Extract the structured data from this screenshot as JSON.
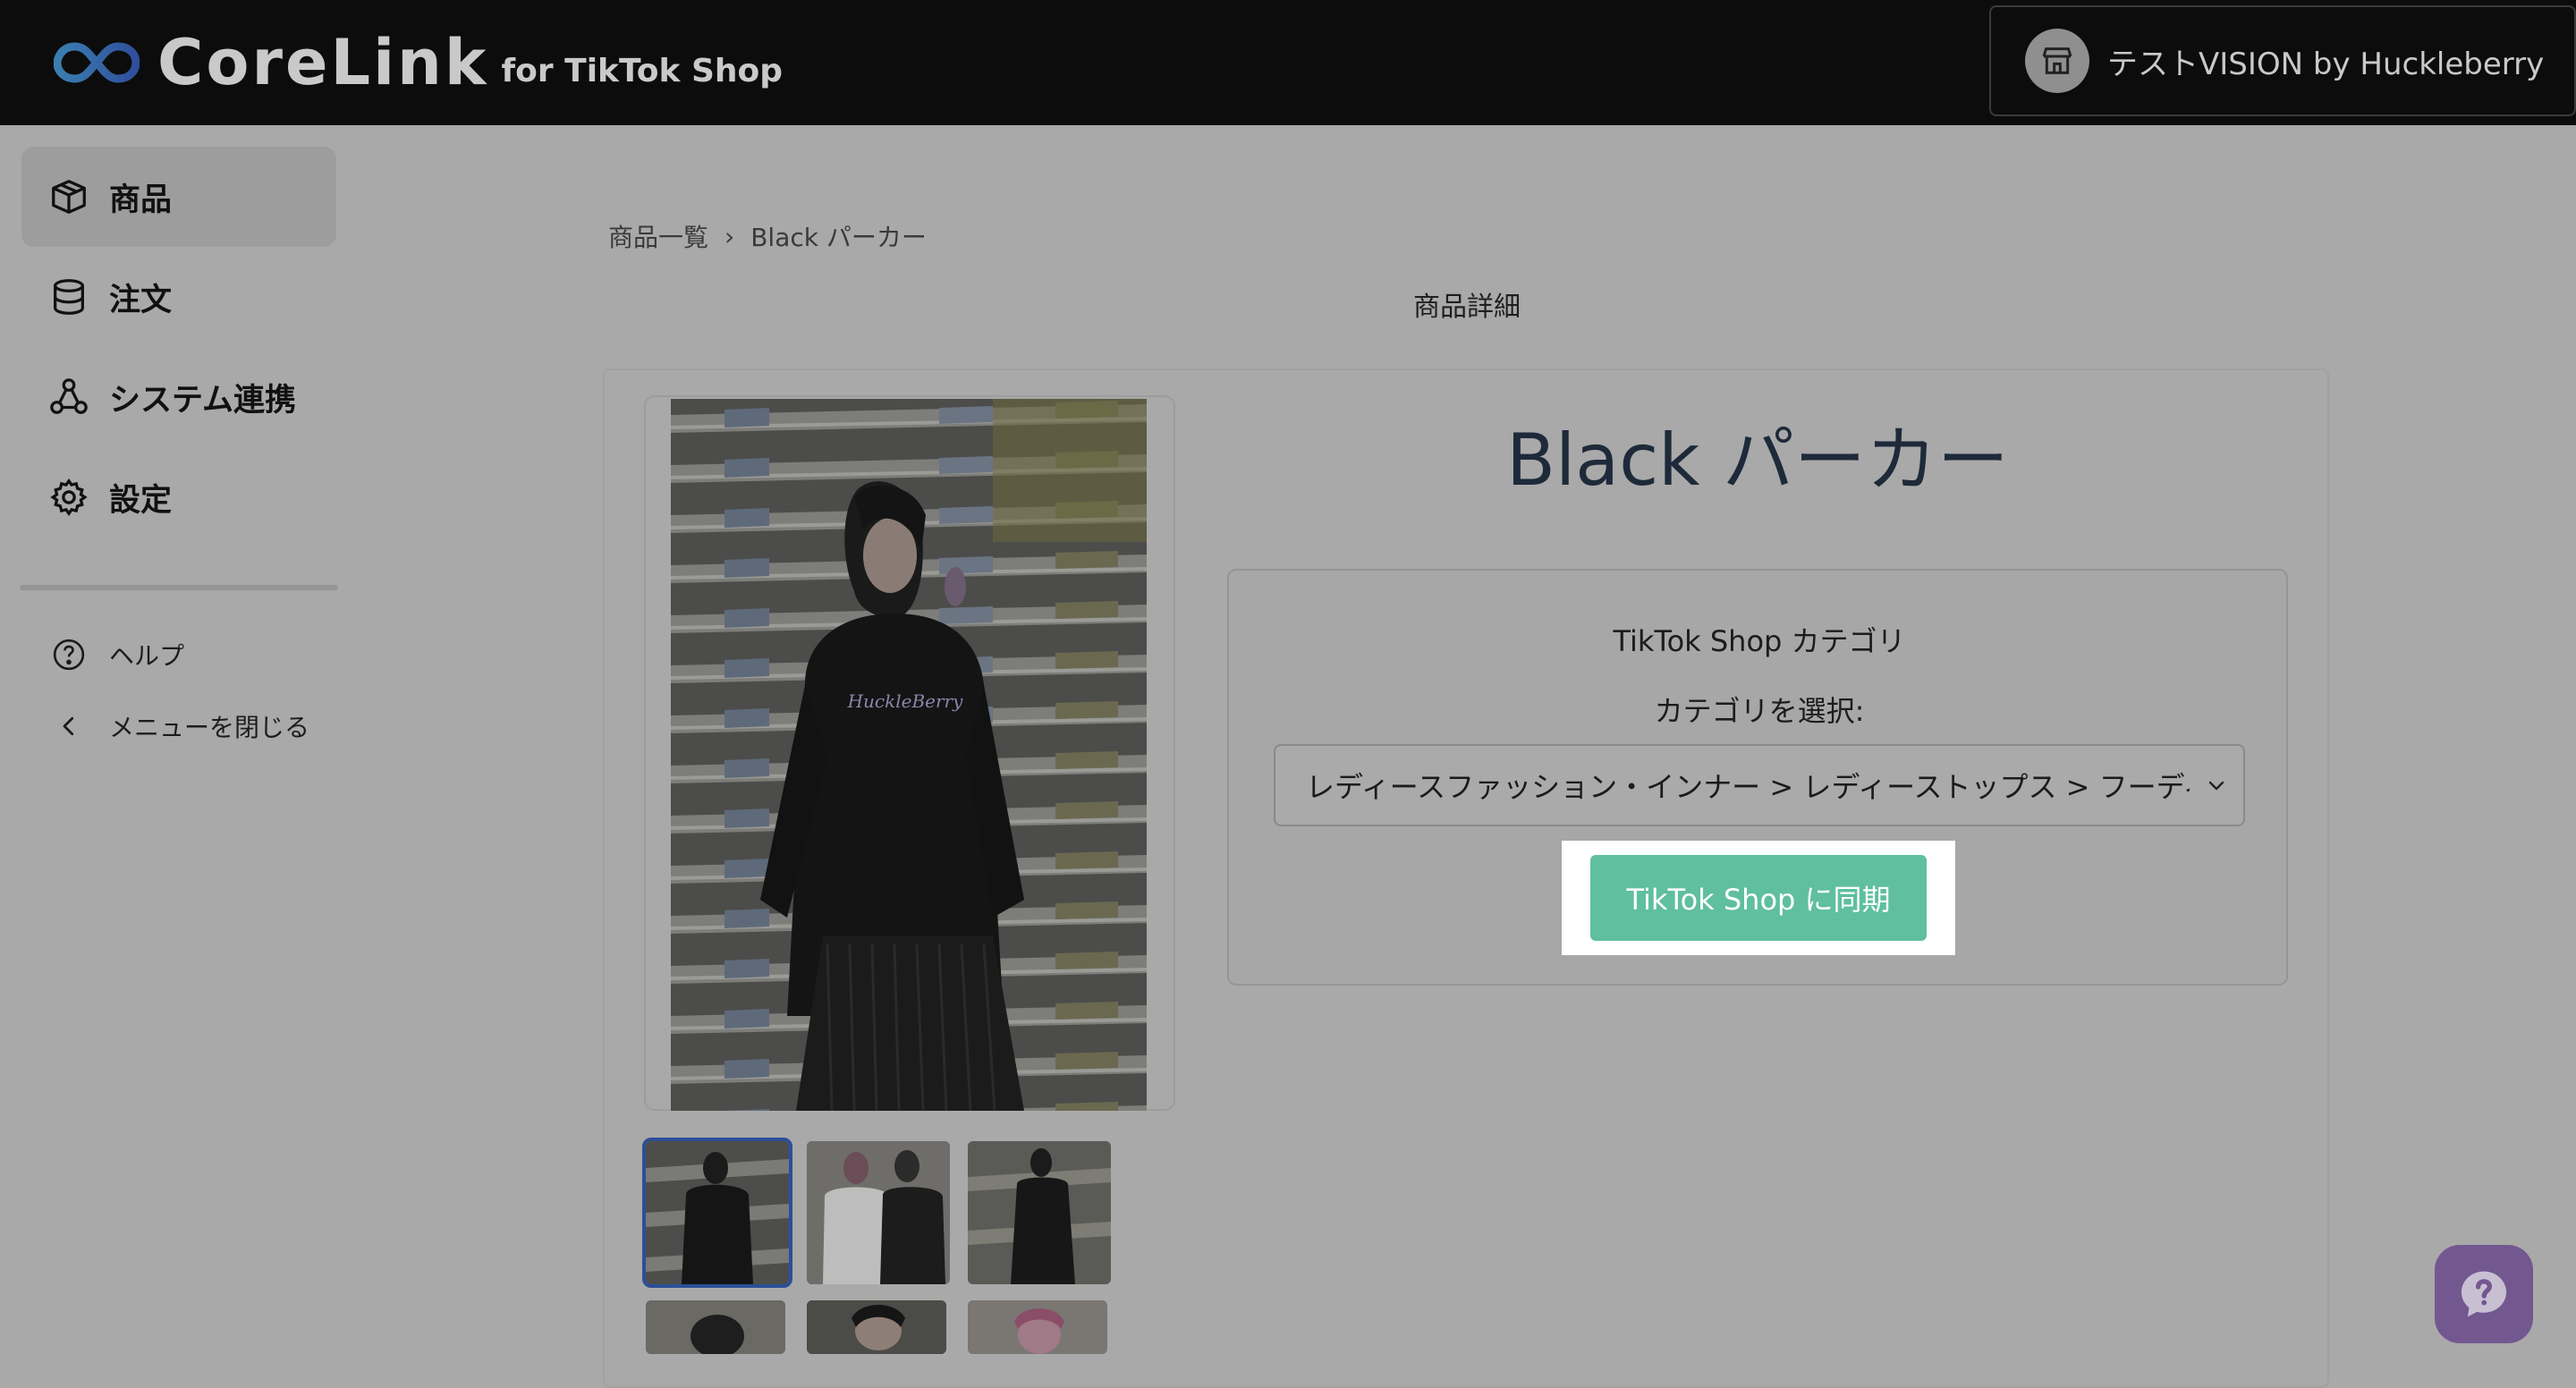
{
  "header": {
    "brand_name": "CoreLink",
    "brand_sub": "for TikTok Shop",
    "shop_name": "テストVISION by Huckleberry"
  },
  "sidebar": {
    "items": [
      {
        "label": "商品",
        "icon": "box-icon",
        "active": true
      },
      {
        "label": "注文",
        "icon": "database-icon",
        "active": false
      },
      {
        "label": "システム連携",
        "icon": "network-icon",
        "active": false
      },
      {
        "label": "設定",
        "icon": "gear-icon",
        "active": false
      }
    ],
    "help_label": "ヘルプ",
    "close_menu_label": "メニューを閉じる"
  },
  "breadcrumb": {
    "parent": "商品一覧",
    "separator": "›",
    "current": "Black パーカー"
  },
  "page": {
    "title": "商品詳細"
  },
  "product": {
    "name": "Black パーカー",
    "category_heading": "TikTok Shop カテゴリ",
    "category_label": "カテゴリを選択:",
    "category_selected": "レディースファッション・インナー > レディーストップス > フーディ-",
    "sync_button": "TikTok Shop に同期"
  },
  "colors": {
    "header_bg": "#0c0c0c",
    "sync_button": "#5fbf9f",
    "help_fab": "#72588f",
    "selected_thumb_border": "#2c4f96"
  }
}
